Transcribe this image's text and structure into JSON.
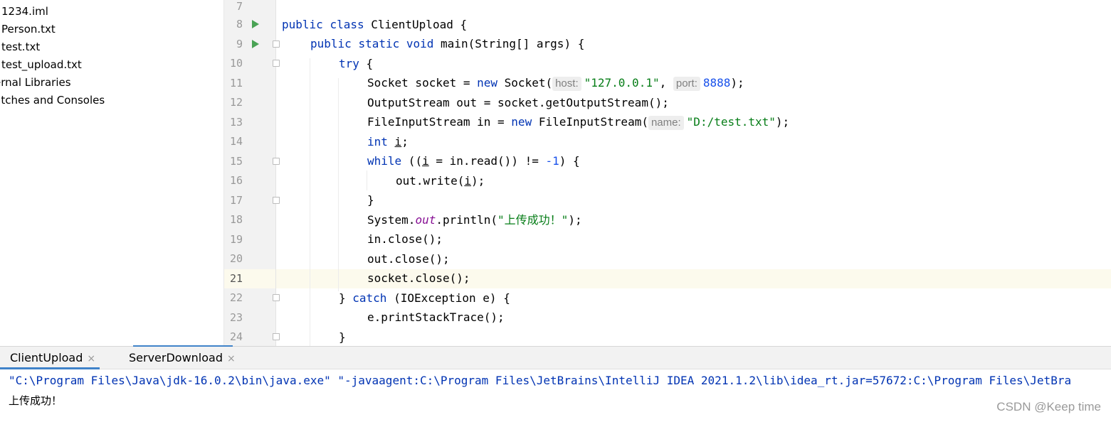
{
  "project_tree": {
    "items": [
      "1234.iml",
      "Person.txt",
      "test.txt",
      "test_upload.txt",
      "ernal Libraries",
      "ratches and Consoles"
    ]
  },
  "editor": {
    "line_numbers": [
      "7",
      "8",
      "9",
      "10",
      "11",
      "12",
      "13",
      "14",
      "15",
      "16",
      "17",
      "18",
      "19",
      "20",
      "21",
      "22",
      "23",
      "24"
    ],
    "current_line": "21",
    "code": {
      "l8": {
        "kw1": "public",
        "kw2": "class",
        "rest": " ClientUpload {"
      },
      "l9": {
        "kw1": "public",
        "kw2": "static",
        "kw3": "void",
        "method": " main",
        "rest": "(String[] args) {"
      },
      "l10": {
        "kw": "try",
        "rest": " {"
      },
      "l11": {
        "a": "Socket socket = ",
        "kw": "new",
        "b": " Socket(",
        "hint1": "host:",
        "str": "\"127.0.0.1\"",
        "c": ", ",
        "hint2": "port:",
        "num": "8888",
        "d": ");"
      },
      "l12": {
        "text": "OutputStream out = socket.getOutputStream();"
      },
      "l13": {
        "a": "FileInputStream in = ",
        "kw": "new",
        "b": " FileInputStream(",
        "hint": "name:",
        "str": "\"D:/test.txt\"",
        "c": ");"
      },
      "l14": {
        "kw": "int",
        "sp": " ",
        "var": "i",
        "rest": ";"
      },
      "l15": {
        "kw": "while",
        "a": " ((",
        "var": "i",
        "b": " = in.read()) != ",
        "num": "-1",
        "c": ") {"
      },
      "l16": {
        "a": "out.write(",
        "var": "i",
        "b": ");"
      },
      "l17": {
        "text": "}"
      },
      "l18": {
        "a": "System.",
        "stat": "out",
        "b": ".println(",
        "str": "\"上传成功！\"",
        "c": ");"
      },
      "l19": {
        "text": "in.close();"
      },
      "l20": {
        "text": "out.close();"
      },
      "l21": {
        "text": "socket.close();"
      },
      "l22": {
        "a": "} ",
        "kw": "catch",
        "b": " (IOException e) {"
      },
      "l23": {
        "text": "e.printStackTrace();"
      },
      "l24": {
        "text": "}"
      }
    }
  },
  "run_window": {
    "tabs": [
      {
        "label": "ClientUpload",
        "close": "×"
      },
      {
        "label": "ServerDownload",
        "close": "×"
      }
    ],
    "command": "\"C:\\Program Files\\Java\\jdk-16.0.2\\bin\\java.exe\" \"-javaagent:C:\\Program Files\\JetBrains\\IntelliJ IDEA 2021.1.2\\lib\\idea_rt.jar=57672:C:\\Program Files\\JetBra",
    "output": "上传成功！"
  },
  "watermark": "CSDN @Keep time",
  "colors": {
    "keyword": "#0033b3",
    "string": "#067d17",
    "number": "#1750eb",
    "static_field": "#871094",
    "run_icon": "#4aa355",
    "tab_accent": "#4083c9"
  }
}
